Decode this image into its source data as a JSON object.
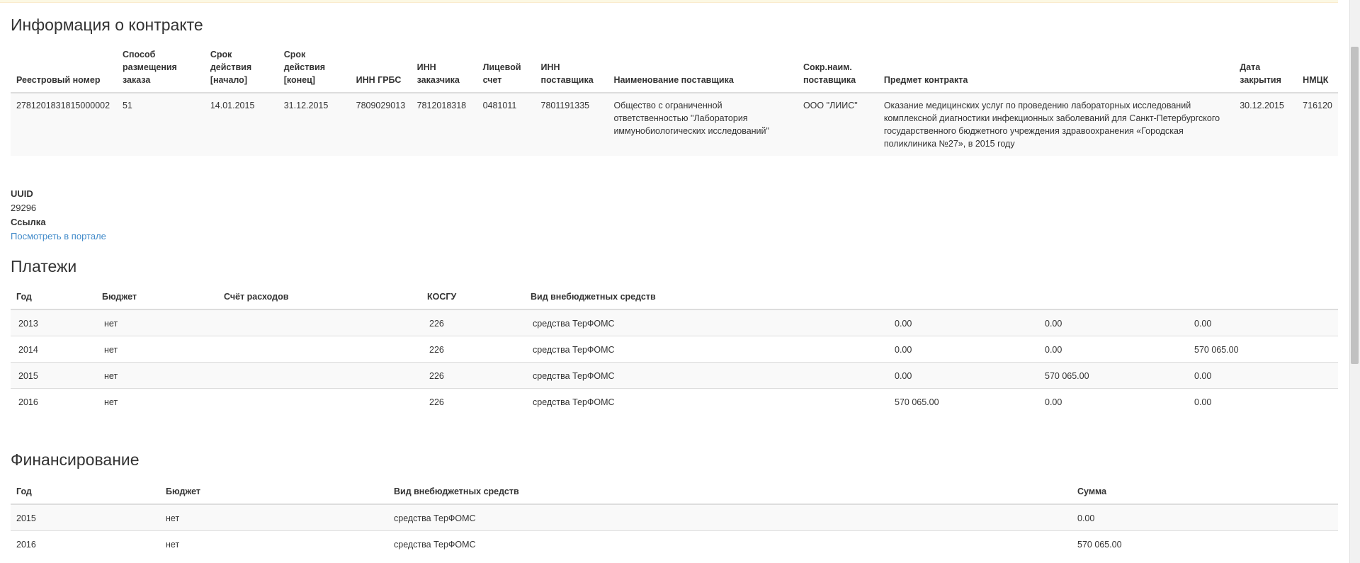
{
  "contract": {
    "title": "Информация о контракте",
    "headers": [
      "Реестровый номер",
      "Способ размещения заказа",
      "Срок действия [начало]",
      "Срок действия [конец]",
      "ИНН ГРБС",
      "ИНН заказчика",
      "Лицевой счет",
      "ИНН поставщика",
      "Наименование поставщика",
      "Сокр.наим. поставщика",
      "Предмет контракта",
      "Дата закрытия",
      "НМЦК"
    ],
    "row": [
      "2781201831815000002",
      "51",
      "14.01.2015",
      "31.12.2015",
      "7809029013",
      "7812018318",
      "0481011",
      "7801191335",
      "Общество с ограниченной ответственностью \"Лаборатория иммунобиологических исследований\"",
      "ООО \"ЛИИС\"",
      "Оказание медицинских услуг по проведению лабораторных исследований комплексной диагностики инфекционных заболеваний для Санкт-Петербургского государственного бюджетного учреждения здравоохранения «Городская поликлиника №27», в 2015 году",
      "30.12.2015",
      "716120"
    ]
  },
  "meta": {
    "uuid_label": "UUID",
    "uuid_value": "29296",
    "link_label": "Ссылка",
    "link_text": "Посмотреть в портале"
  },
  "payments": {
    "title": "Платежи",
    "headers": [
      "Год",
      "Бюджет",
      "Счёт расходов",
      "КОСГУ",
      "Вид внебюджетных средств",
      "",
      "",
      ""
    ],
    "rows": [
      [
        "2013",
        "нет",
        "",
        "226",
        "средства ТерФОМС",
        "0.00",
        "0.00",
        "0.00"
      ],
      [
        "2014",
        "нет",
        "",
        "226",
        "средства ТерФОМС",
        "0.00",
        "0.00",
        "570 065.00"
      ],
      [
        "2015",
        "нет",
        "",
        "226",
        "средства ТерФОМС",
        "0.00",
        "570 065.00",
        "0.00"
      ],
      [
        "2016",
        "нет",
        "",
        "226",
        "средства ТерФОМС",
        "570 065.00",
        "0.00",
        "0.00"
      ]
    ]
  },
  "financing": {
    "title": "Финансирование",
    "headers": [
      "Год",
      "Бюджет",
      "Вид внебюджетных средств",
      "Сумма"
    ],
    "rows": [
      [
        "2015",
        "нет",
        "средства ТерФОМС",
        "0.00"
      ],
      [
        "2016",
        "нет",
        "средства ТерФОМС",
        "570 065.00"
      ]
    ]
  }
}
